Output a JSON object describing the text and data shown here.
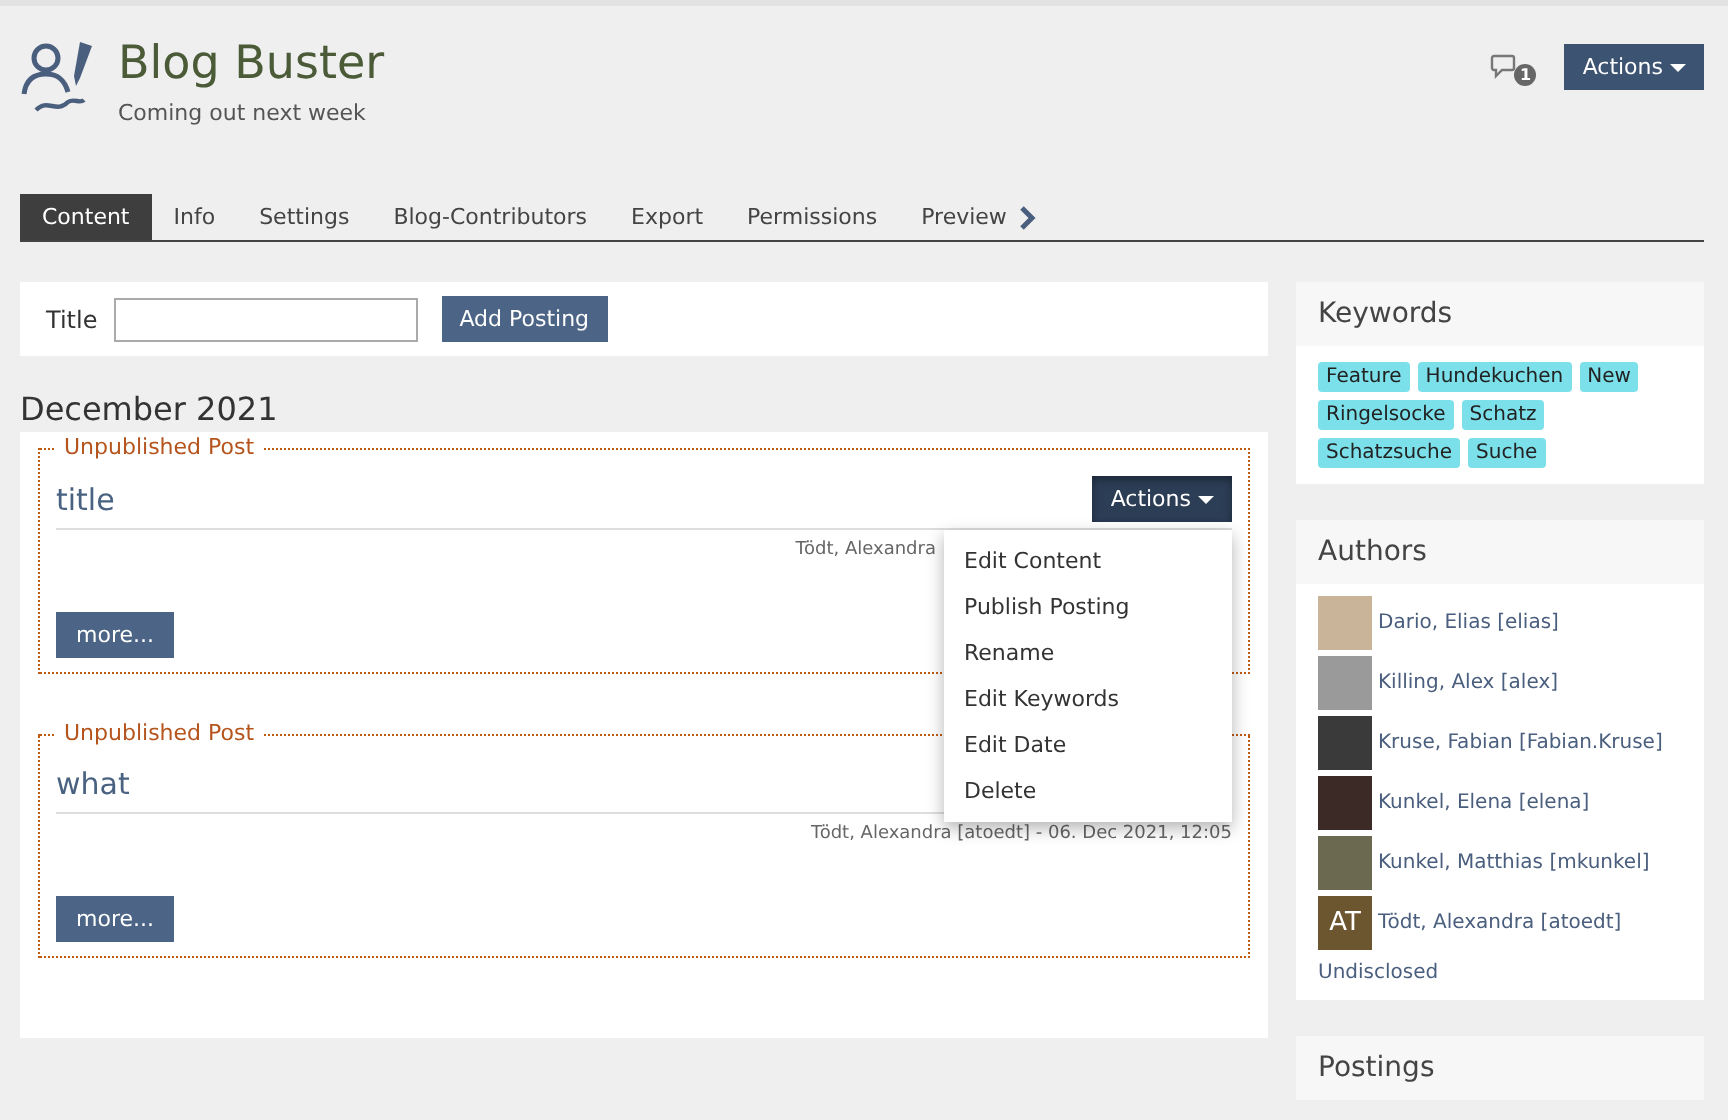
{
  "header": {
    "title": "Blog Buster",
    "subtitle": "Coming out next week",
    "notification_count": "1",
    "actions_button": "Actions"
  },
  "tabs": [
    {
      "label": "Content",
      "selected": true
    },
    {
      "label": "Info",
      "selected": false
    },
    {
      "label": "Settings",
      "selected": false
    },
    {
      "label": "Blog-Contributors",
      "selected": false
    },
    {
      "label": "Export",
      "selected": false
    },
    {
      "label": "Permissions",
      "selected": false
    },
    {
      "label": "Preview",
      "selected": false
    }
  ],
  "add_posting": {
    "label": "Title",
    "button": "Add Posting"
  },
  "month_heading": "December 2021",
  "postings": [
    {
      "status": "Unpublished Post",
      "title": "title",
      "meta": "Tödt, Alexandra",
      "actions_button": "Actions",
      "expanded": true,
      "more_button": "more..."
    },
    {
      "status": "Unpublished Post",
      "title": "what",
      "meta": "Tödt, Alexandra [atoedt] - 06. Dec 2021, 12:05",
      "more_button": "more..."
    }
  ],
  "actions_menu": [
    "Edit Content",
    "Publish Posting",
    "Rename",
    "Edit Keywords",
    "Edit Date",
    "Delete"
  ],
  "keywords": {
    "title": "Keywords",
    "tags": [
      "Feature",
      "Hundekuchen",
      "New",
      "Ringelsocke",
      "Schatz",
      "Schatzsuche",
      "Suche"
    ]
  },
  "authors": {
    "title": "Authors",
    "items": [
      {
        "name": "Dario, Elias [elias]",
        "kind": "photo"
      },
      {
        "name": "Killing, Alex [alex]",
        "kind": "photo"
      },
      {
        "name": "Kruse, Fabian [Fabian.Kruse]",
        "kind": "photo"
      },
      {
        "name": "Kunkel, Elena [elena]",
        "kind": "photo"
      },
      {
        "name": "Kunkel, Matthias [mkunkel]",
        "kind": "photo"
      },
      {
        "name": "Tödt, Alexandra [atoedt]",
        "kind": "initials",
        "initials": "AT"
      }
    ],
    "undisclosed": "Undisclosed"
  },
  "postings_panel": {
    "title": "Postings"
  }
}
